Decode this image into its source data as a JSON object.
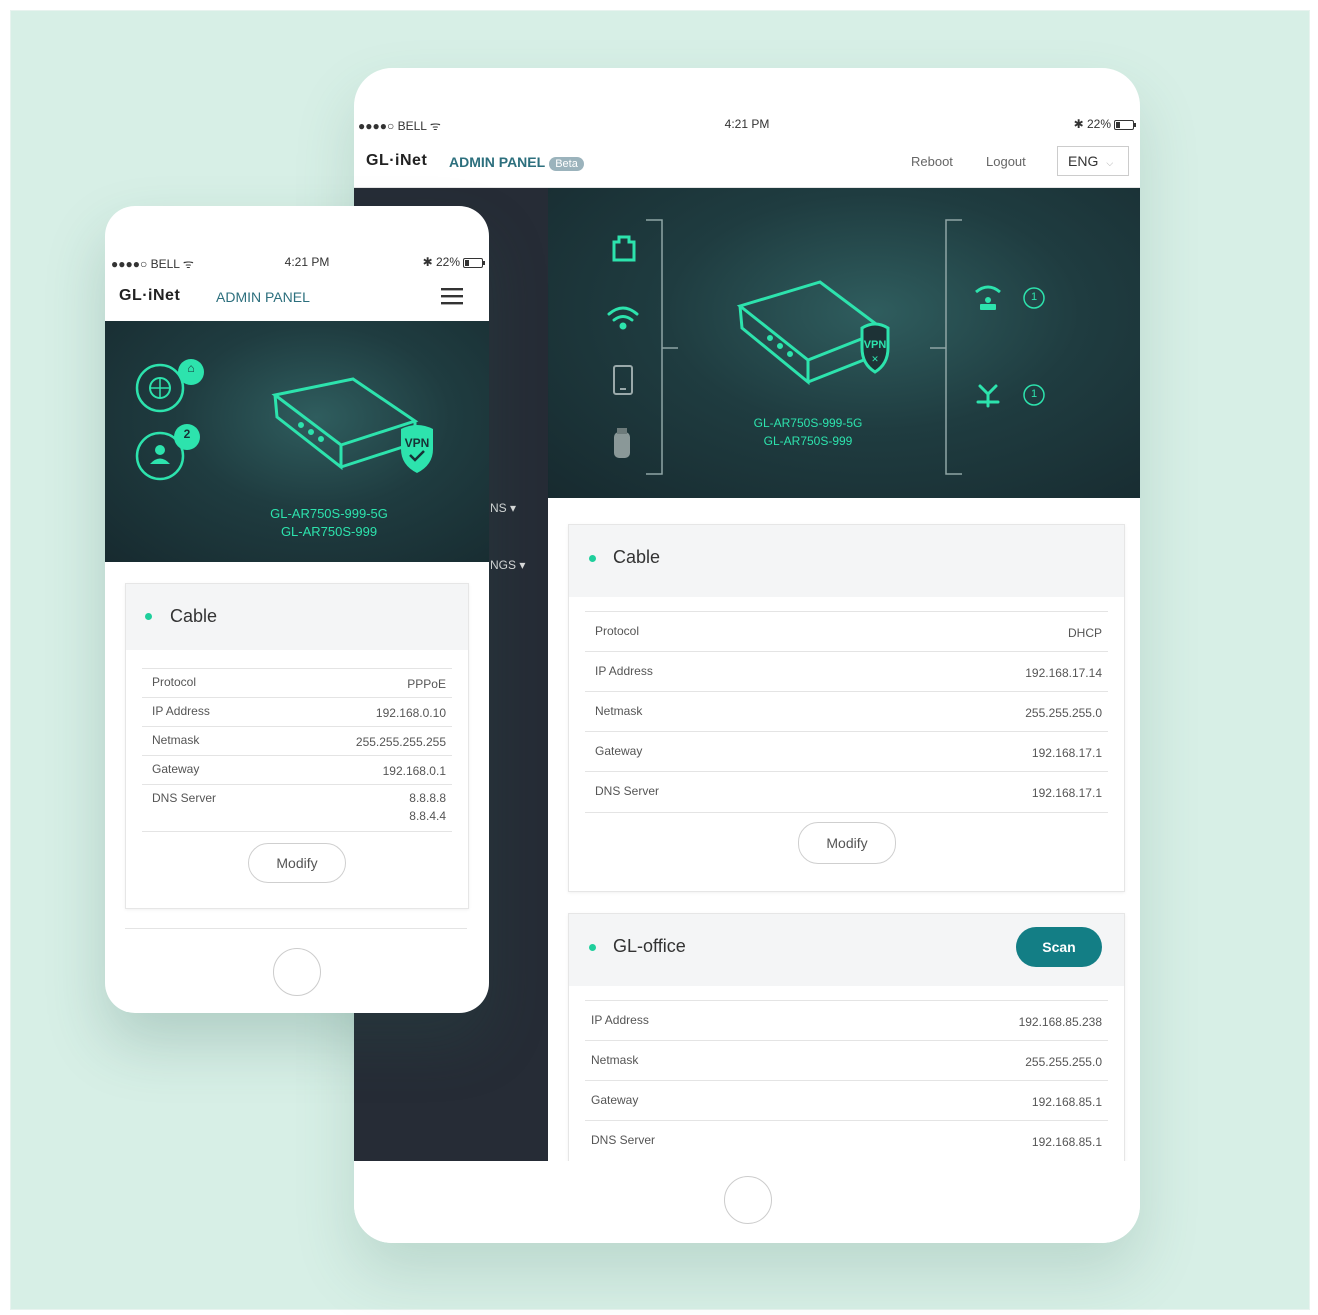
{
  "status": {
    "carrier": "●●●●○ BELL ᯤ",
    "time": "4:21 PM",
    "battery": "✱ 22%"
  },
  "brand": {
    "logo_left": "GL·",
    "logo_right": "iNet",
    "panel": "ADMIN PANEL",
    "beta": "Beta"
  },
  "tablet": {
    "reboot": "Reboot",
    "logout": "Logout",
    "lang": "ENG",
    "sidebar_ghost_1": "NS ▾",
    "sidebar_ghost_2": "NGS ▾",
    "device_names": [
      "GL-AR750S-999-5G",
      "GL-AR750S-999"
    ],
    "client_counts": [
      "1",
      "1"
    ],
    "cable": {
      "title": "Cable",
      "rows": [
        {
          "label": "Protocol",
          "value": "DHCP"
        },
        {
          "label": "IP Address",
          "value": "192.168.17.14"
        },
        {
          "label": "Netmask",
          "value": "255.255.255.0"
        },
        {
          "label": "Gateway",
          "value": "192.168.17.1"
        },
        {
          "label": "DNS Server",
          "value": "192.168.17.1"
        }
      ],
      "modify": "Modify"
    },
    "wifi": {
      "title": "GL-office",
      "scan": "Scan",
      "rows": [
        {
          "label": "IP Address",
          "value": "192.168.85.238"
        },
        {
          "label": "Netmask",
          "value": "255.255.255.0"
        },
        {
          "label": "Gateway",
          "value": "192.168.85.1"
        },
        {
          "label": "DNS Server",
          "value": "192.168.85.1"
        }
      ]
    }
  },
  "phone": {
    "device_names": [
      "GL-AR750S-999-5G",
      "GL-AR750S-999"
    ],
    "badges": [
      "⌂",
      "2"
    ],
    "cable": {
      "title": "Cable",
      "rows": [
        {
          "label": "Protocol",
          "value": "PPPoE"
        },
        {
          "label": "IP Address",
          "value": "192.168.0.10"
        },
        {
          "label": "Netmask",
          "value": "255.255.255.255"
        },
        {
          "label": "Gateway",
          "value": "192.168.0.1"
        },
        {
          "label": "DNS Server",
          "value": "8.8.8.8",
          "value2": "8.8.4.4"
        }
      ],
      "modify": "Modify"
    }
  },
  "colors": {
    "accent": "#1fcf9c",
    "neon": "#2de3ad",
    "scan_button": "#137e85",
    "sidebar": "#262c36",
    "backdrop": "#d7efe6"
  },
  "icons": [
    "ethernet-icon",
    "wifi-icon",
    "phone-icon",
    "usb-icon",
    "router-icon",
    "vpn-shield-icon",
    "wifi-repeater-icon",
    "antenna-icon",
    "globe-icon",
    "user-icon",
    "hamburger-menu-icon",
    "home-button"
  ]
}
